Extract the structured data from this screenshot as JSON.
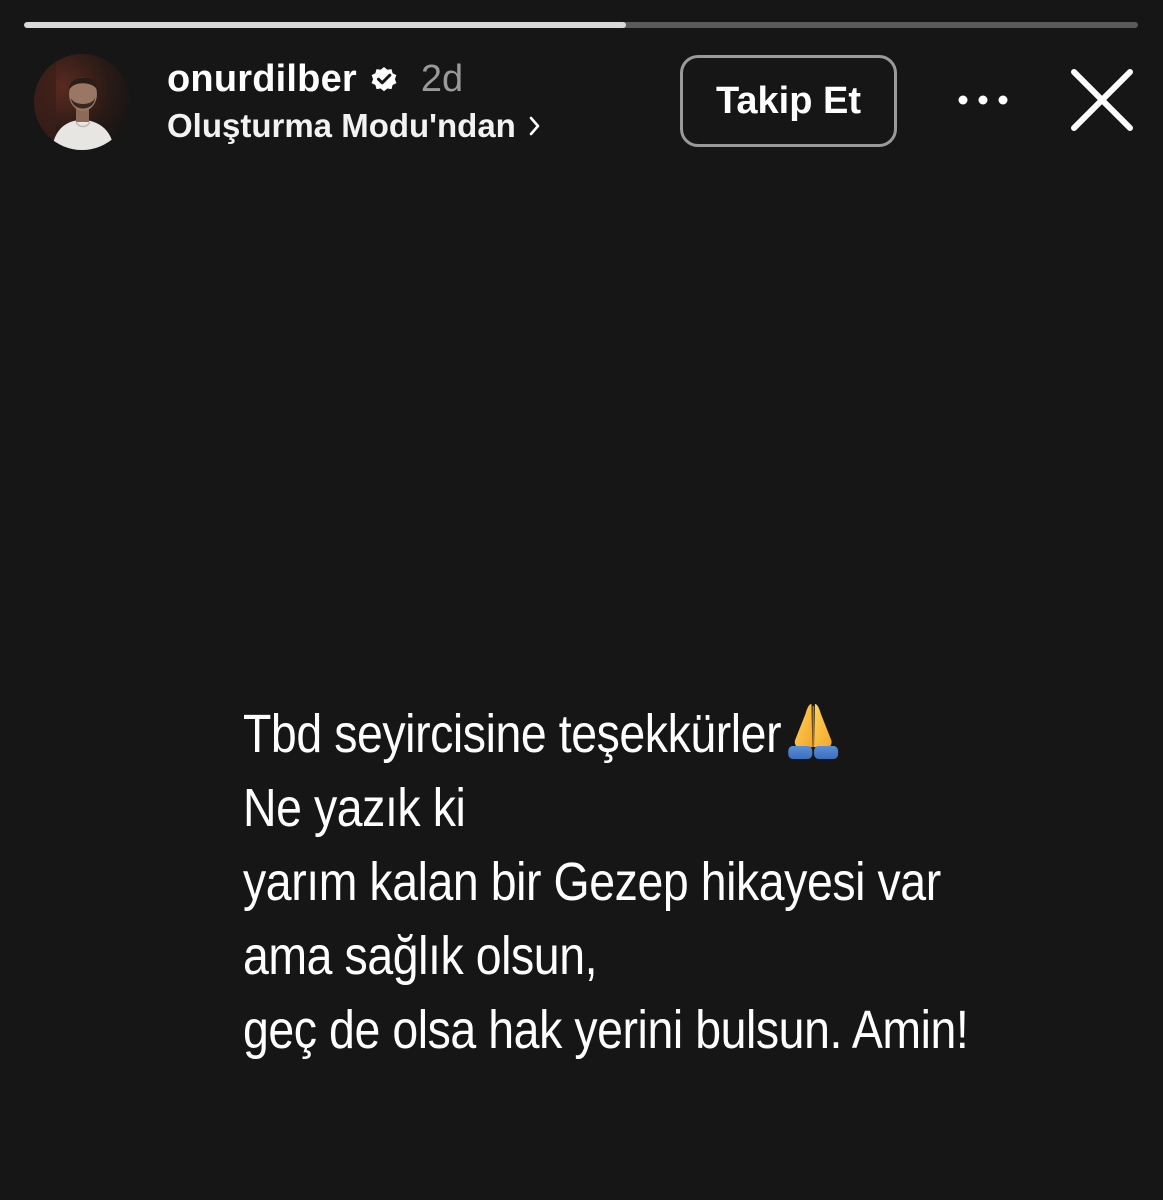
{
  "progress": {
    "fraction": 0.54,
    "fill_color": "#d9d9d9",
    "track_color": "#5a5a5a"
  },
  "header": {
    "username": "onurdilber",
    "verified": true,
    "time": "2d",
    "subtitle": "Oluşturma Modu'ndan",
    "follow_label": "Takip Et",
    "icons": {
      "avatar": "profile-photo",
      "verified": "verified-badge-icon",
      "chevron": "chevron-right-icon",
      "more": "more-dots-icon",
      "close": "close-icon"
    }
  },
  "story": {
    "background": "#161616",
    "lines": [
      "Tbd seyircisine teşekkürler",
      "Ne yazık ki",
      "yarım kalan bir Gezep hikayesi var",
      "ama sağlık olsun,",
      "geç de olsa hak yerini bulsun. Amin!"
    ],
    "emoji": "folded-hands-emoji"
  }
}
